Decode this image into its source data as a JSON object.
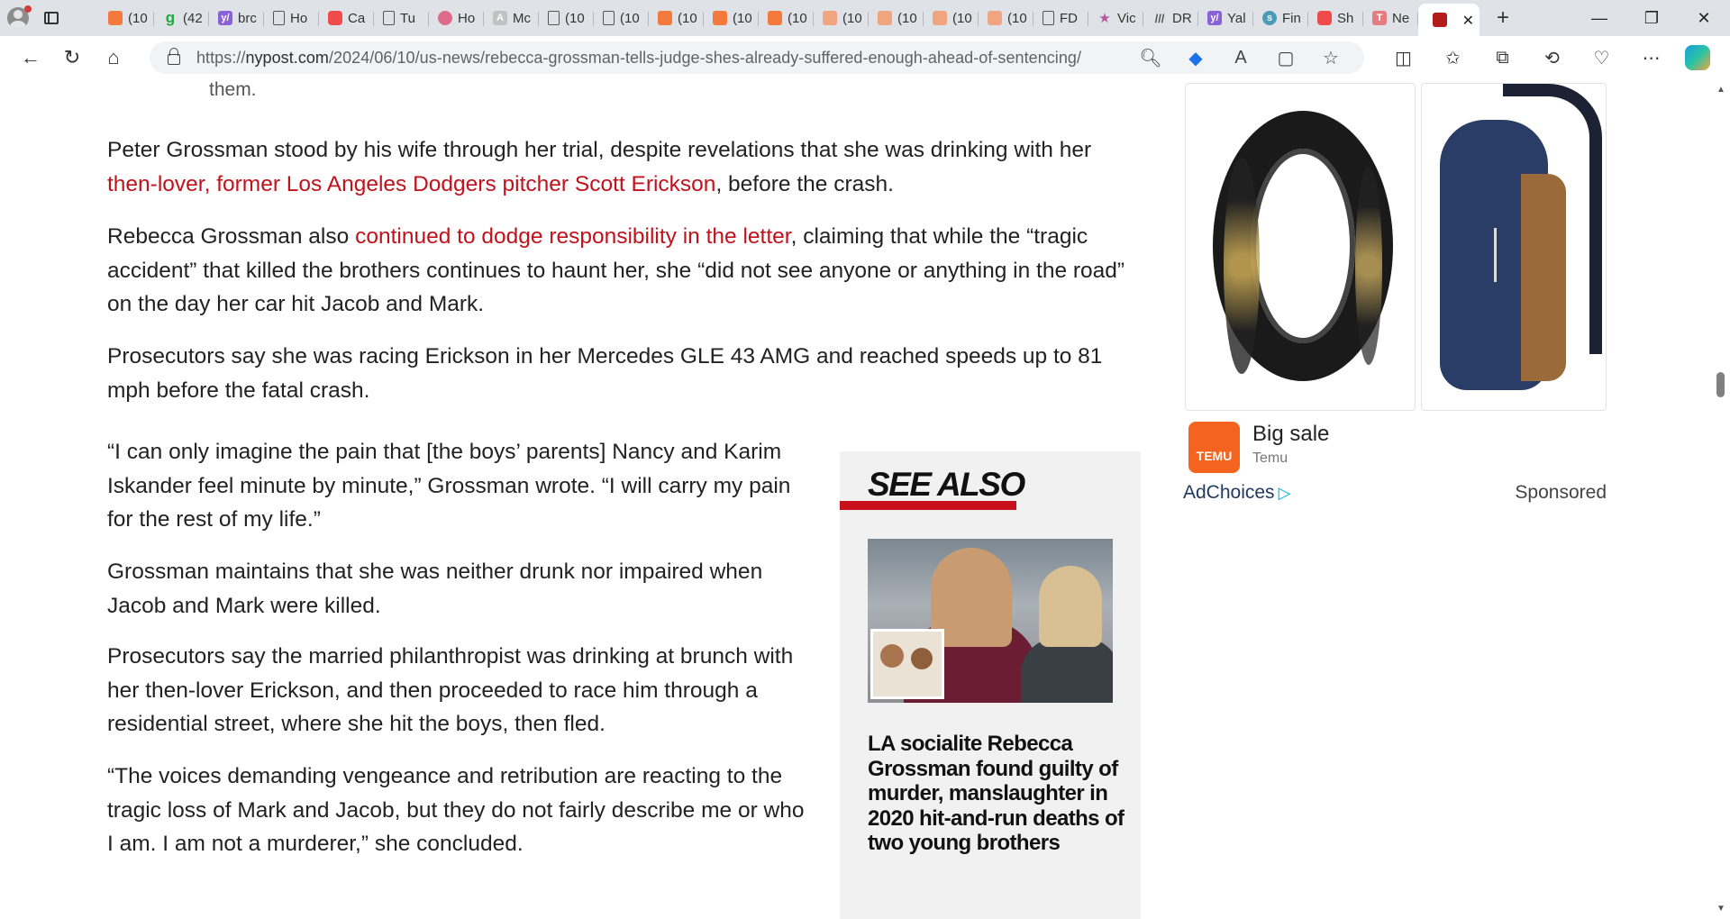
{
  "browser": {
    "tabs": [
      {
        "label": "(10",
        "icon": "orange"
      },
      {
        "label": "(42",
        "icon": "green",
        "glyph": "g"
      },
      {
        "label": "brc",
        "icon": "yahoo",
        "glyph": "y/"
      },
      {
        "label": "Ho",
        "icon": "doc"
      },
      {
        "label": "Ca",
        "icon": "yt"
      },
      {
        "label": "Tu",
        "icon": "doc"
      },
      {
        "label": "Ho",
        "icon": "pink"
      },
      {
        "label": "Mc",
        "icon": "gray",
        "glyph": "A"
      },
      {
        "label": "(10",
        "icon": "doc"
      },
      {
        "label": "(10",
        "icon": "doc"
      },
      {
        "label": "(10",
        "icon": "orange"
      },
      {
        "label": "(10",
        "icon": "orange"
      },
      {
        "label": "(10",
        "icon": "orange"
      },
      {
        "label": "(10",
        "icon": "peach"
      },
      {
        "label": "(10",
        "icon": "peach"
      },
      {
        "label": "(10",
        "icon": "peach"
      },
      {
        "label": "(10",
        "icon": "peach"
      },
      {
        "label": "FD",
        "icon": "doc"
      },
      {
        "label": "Vic",
        "icon": "star",
        "glyph": "★"
      },
      {
        "label": "DR",
        "icon": "stripes",
        "glyph": "///"
      },
      {
        "label": "Yal",
        "icon": "yahoo",
        "glyph": "y/"
      },
      {
        "label": "Fin",
        "icon": "teal",
        "glyph": "s"
      },
      {
        "label": "Sh",
        "icon": "yt"
      },
      {
        "label": "Ne",
        "icon": "pinksq",
        "glyph": "T"
      }
    ],
    "active_tab_close": "✕",
    "new_tab": "+",
    "window": {
      "minimize": "—",
      "maximize": "❐",
      "close": "✕"
    },
    "url_prefix": "https://",
    "url_host": "nypost.com",
    "url_path": "/2024/06/10/us-news/rebecca-grossman-tells-judge-shes-already-suffered-enough-ahead-of-sentencing/"
  },
  "article": {
    "caption_tail": "them.",
    "p1_before": "Peter Grossman stood by his wife through her trial, despite revelations that she was drinking with her ",
    "p1_link": "then-lover, former Los Angeles Dodgers pitcher Scott Erickson",
    "p1_after": ", before the crash.",
    "p2_before": "Rebecca Grossman also ",
    "p2_link": "continued to dodge responsibility in the letter",
    "p2_after": ", claiming that while the “tragic accident” that killed the brothers continues to haunt her, she “did not see anyone or anything in the road” on the day her car hit Jacob and Mark.",
    "p3": "Prosecutors say she was racing Erickson in her Mercedes GLE 43 AMG and reached speeds up to 81 mph before the fatal crash.",
    "p4": "“I can only imagine the pain that [the boys’ parents] Nancy and Karim Iskander feel minute by minute,” Grossman wrote. “I will carry my pain for the rest of my life.”",
    "p5": "Grossman maintains that she was neither drunk nor impaired when Jacob and Mark were killed.",
    "p6": "Prosecutors say the married philanthropist was drinking at brunch with her then-lover Erickson, and then proceeded to race him through a residential street, where she hit the boys, then fled.",
    "p7": "“The voices demanding vengeance and retribution are reacting to the tragic loss of Mark and Jacob, but they do not fairly describe me or who I am. I am not a murderer,” she concluded."
  },
  "see_also": {
    "title": "SEE ALSO",
    "headline": "LA socialite Rebecca Grossman found guilty of murder, manslaughter in 2020 hit-and-run deaths of two young brothers"
  },
  "ad": {
    "logo_text": "TEMU",
    "title": "Big sale",
    "brand": "Temu",
    "adchoices": "AdChoices",
    "sponsored": "Sponsored"
  },
  "colors": {
    "link": "#c1121c",
    "accent_bar": "#c8101d",
    "temu": "#f5641e"
  }
}
